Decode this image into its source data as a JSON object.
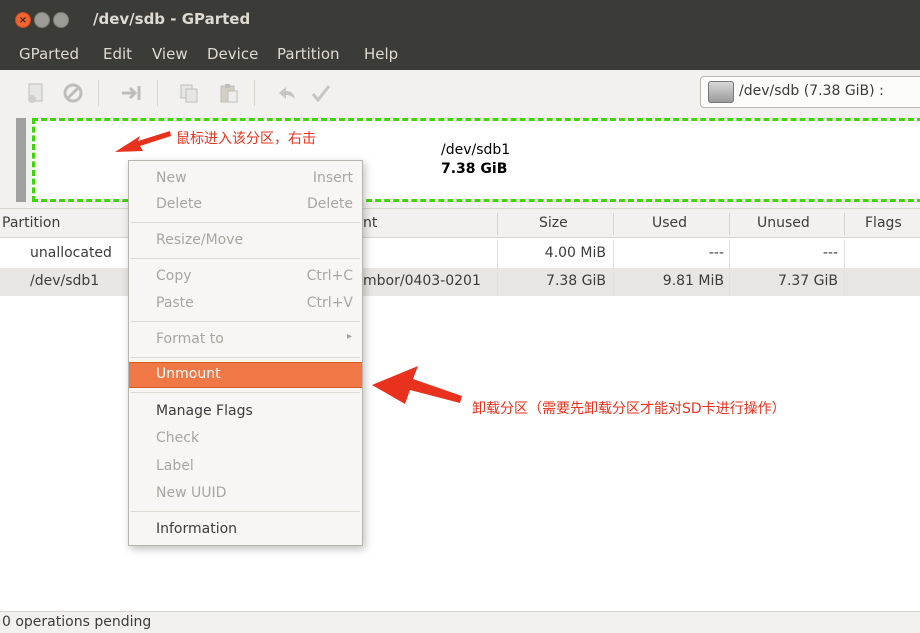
{
  "window": {
    "title": "/dev/sdb - GParted"
  },
  "menubar": [
    "GParted",
    "Edit",
    "View",
    "Device",
    "Partition",
    "Help"
  ],
  "toolbar": {
    "device_selector": "/dev/sdb   (7.38 GiB)  :"
  },
  "partition_map": {
    "name": "/dev/sdb1",
    "size": "7.38 GiB"
  },
  "table": {
    "headers": [
      "Partition",
      "nt",
      "Size",
      "Used",
      "Unused",
      "Flags"
    ],
    "rows": [
      {
        "partition": "unallocated",
        "mount": "",
        "size": "4.00 MiB",
        "used": "---",
        "unused": "---",
        "flags": ""
      },
      {
        "partition": "/dev/sdb1",
        "mount": "mbor/0403-0201",
        "size": "7.38 GiB",
        "used": "9.81 MiB",
        "unused": "7.37 GiB",
        "flags": ""
      }
    ]
  },
  "context_menu": {
    "new": "New",
    "new_acc": "Insert",
    "delete": "Delete",
    "delete_acc": "Delete",
    "resize": "Resize/Move",
    "copy": "Copy",
    "copy_acc": "Ctrl+C",
    "paste": "Paste",
    "paste_acc": "Ctrl+V",
    "format": "Format to",
    "unmount": "Unmount",
    "manage_flags": "Manage Flags",
    "check": "Check",
    "label": "Label",
    "new_uuid": "New UUID",
    "information": "Information"
  },
  "annotations": {
    "right_click": "鼠标进入该分区，右击",
    "unmount_note": "卸载分区（需要先卸载分区才能对SD卡进行操作）"
  },
  "status": "0 operations pending",
  "colors": {
    "highlight": "#f07746",
    "annotation": "#e8321e",
    "selection_border": "#40d40a"
  }
}
